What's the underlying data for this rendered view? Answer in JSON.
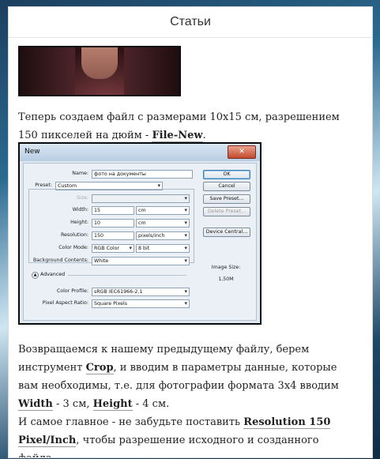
{
  "card": {
    "title": "Статьи"
  },
  "paragraph1": {
    "t1": "Теперь создаем файл с размерами 10х15 см, разрешением 150 пикселей на дюйм - ",
    "b1": "File-New",
    "t2": "."
  },
  "dialog": {
    "title": "New",
    "close": "✕",
    "name_label": "Name:",
    "name_value": "фото на документы",
    "preset_label": "Preset:",
    "preset_value": "Custom",
    "size_label": "Size:",
    "width_label": "Width:",
    "width_value": "15",
    "width_unit": "cm",
    "height_label": "Height:",
    "height_value": "10",
    "height_unit": "cm",
    "resolution_label": "Resolution:",
    "resolution_value": "150",
    "resolution_unit": "pixels/inch",
    "color_mode_label": "Color Mode:",
    "color_mode_value": "RGB Color",
    "bit_value": "8 bit",
    "bg_label": "Background Contents:",
    "bg_value": "White",
    "advanced_label": "Advanced",
    "profile_label": "Color Profile:",
    "profile_value": "sRGB IEC61966-2.1",
    "aspect_label": "Pixel Aspect Ratio:",
    "aspect_value": "Square Pixels",
    "buttons": {
      "ok": "OK",
      "cancel": "Cancel",
      "save_preset": "Save Preset...",
      "delete_preset": "Delete Preset...",
      "device_central": "Device Central..."
    },
    "image_size_label": "Image Size:",
    "image_size_value": "1,50M"
  },
  "paragraph2": {
    "t1": "Возвращаемся к нашему предыдущему файлу, берем инструмент ",
    "b1": "Crop",
    "t2": ", и вводим в параметры данные, которые вам необходимы, т.е. для фотографии формата 3х4 вводим ",
    "b2": "Width",
    "t3": " - 3 см, ",
    "b3": "Height",
    "t4": " - 4 см.",
    "t5": "И самое главное - не забудьте поставить ",
    "b4": "Resolution 150 Pixel/Inch",
    "t6": ", чтобы разрешение исходного и созданного файла"
  }
}
